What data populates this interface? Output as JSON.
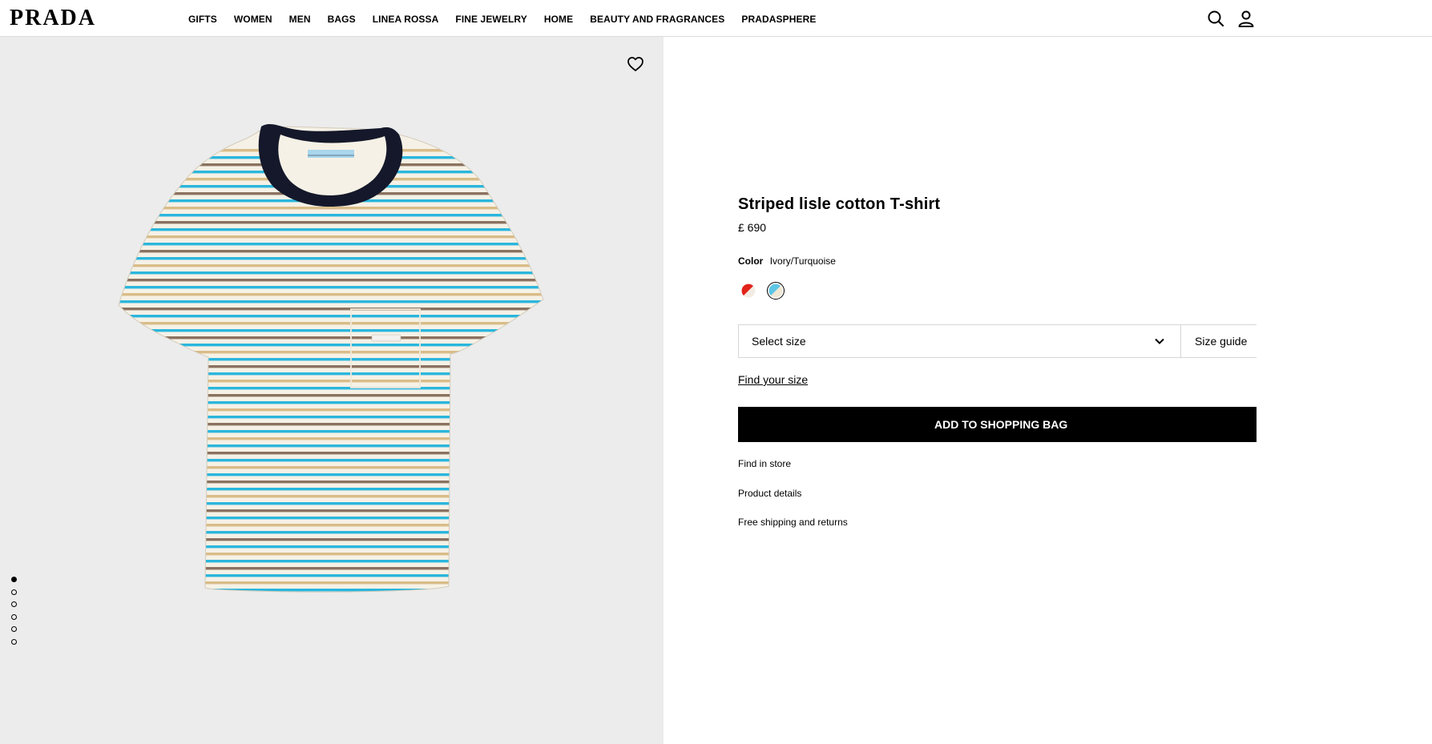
{
  "header": {
    "logo": "PRADA",
    "nav": [
      "GIFTS",
      "WOMEN",
      "MEN",
      "BAGS",
      "LINEA ROSSA",
      "FINE JEWELRY",
      "HOME",
      "BEAUTY AND FRAGRANCES",
      "PRADASPHERE"
    ],
    "icons": {
      "search": "search-icon",
      "account": "account-icon"
    }
  },
  "gallery": {
    "wishlist_icon": "heart-icon",
    "image_count": 6,
    "active_index": 0,
    "shirt_colors": {
      "body": "#f6f1e6",
      "turquoise": "#2bb6dd",
      "tan": "#d9bc88",
      "brown": "#8a7260",
      "collar": "#14182a",
      "label": "#a8d6ec"
    }
  },
  "product": {
    "title": "Striped lisle cotton T-shirt",
    "price": "£ 690",
    "color_label": "Color",
    "color_value": "Ivory/Turquoise",
    "swatches": [
      {
        "name": "red-white",
        "colors": [
          "#e2231a",
          "#f2ede4"
        ],
        "selected": false
      },
      {
        "name": "ivory-turquoise",
        "colors": [
          "#5ec6e6",
          "#efe7d3"
        ],
        "selected": true
      }
    ],
    "size_select": "Select size",
    "size_guide": "Size guide",
    "find_size": "Find your size",
    "add_to_bag": "ADD TO SHOPPING BAG",
    "links": [
      "Find in store",
      "Product details",
      "Free shipping and returns"
    ]
  }
}
